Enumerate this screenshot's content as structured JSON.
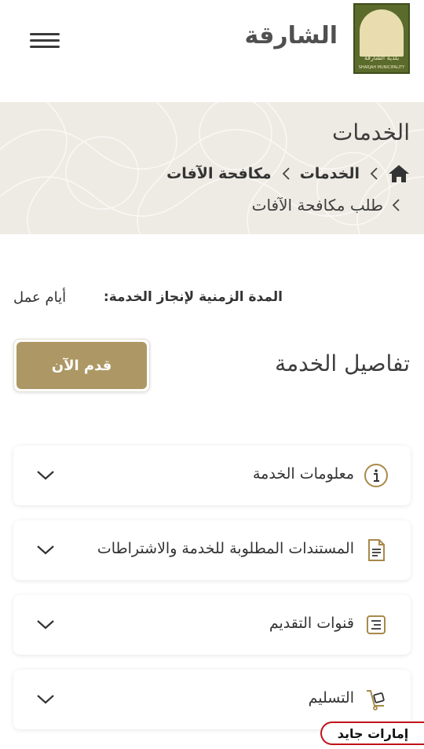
{
  "header": {
    "brand_title": "الشارقة",
    "logo_text_ar": "بلدية الشارقة",
    "logo_text_en": "SHARJAH MUNICIPALITY"
  },
  "banner": {
    "title": "الخدمات",
    "breadcrumb": [
      {
        "label": "الخدمات"
      },
      {
        "label": "مكافحة الآفات"
      }
    ],
    "current": "طلب مكافحة الآفات"
  },
  "service": {
    "duration_label": "المدة الزمنية لإنجاز الخدمة:",
    "duration_value": "أيام عمل",
    "details_title": "تفاصيل الخدمة",
    "apply_label": "قدم الآن"
  },
  "sections": [
    {
      "label": "معلومات الخدمة",
      "icon": "info-icon"
    },
    {
      "label": "المستندات المطلوبة للخدمة والاشتراطات",
      "icon": "document-icon"
    },
    {
      "label": "قنوات التقديم",
      "icon": "channels-icon"
    },
    {
      "label": "التسليم",
      "icon": "delivery-icon"
    }
  ],
  "watermark": "إمارات جايد",
  "colors": {
    "accent": "#ad9865",
    "icon_gold": "#a8894a",
    "banner_bg": "#eeebe4",
    "logo_green": "#5a6b2b"
  }
}
